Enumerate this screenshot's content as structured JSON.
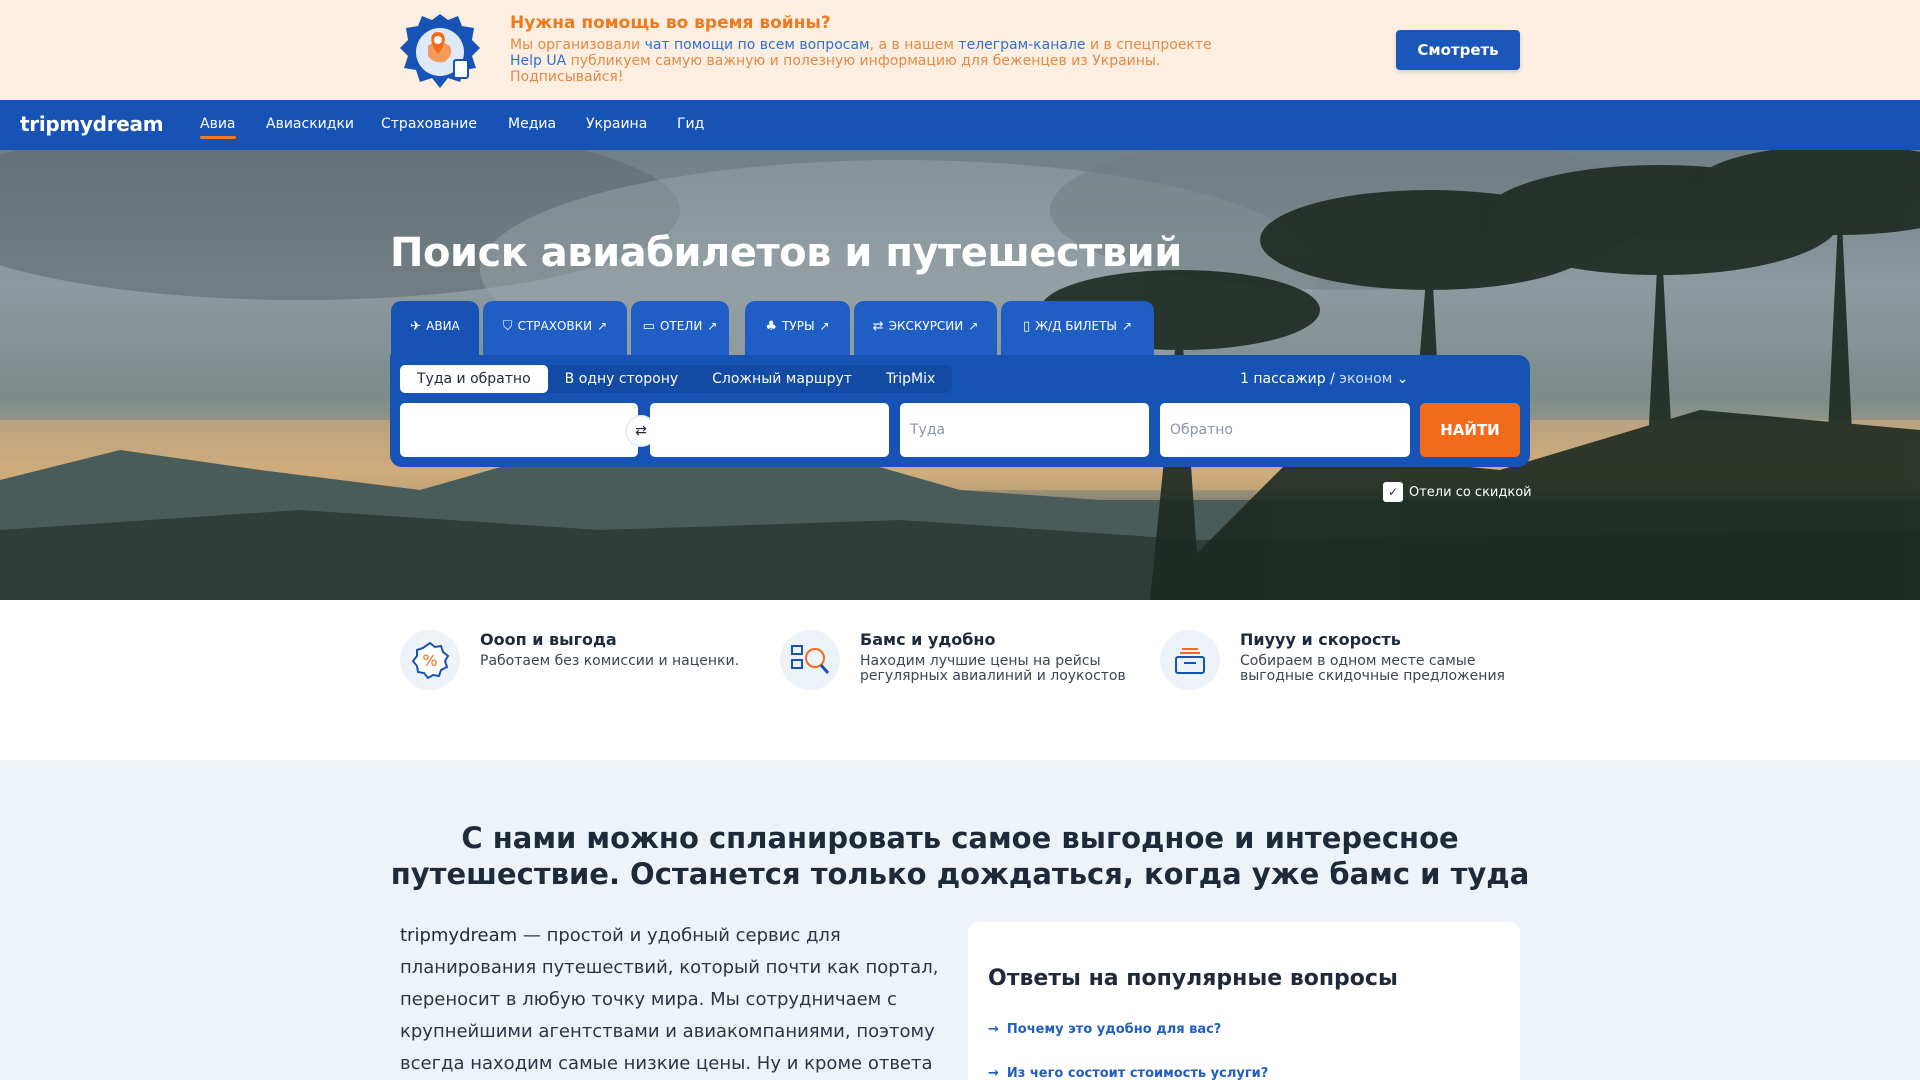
{
  "banner": {
    "title": "Нужна помощь во время войны?",
    "text_1": "Мы организовали ",
    "link_chat": "чат помощи по всем вопросам",
    "text_2": ", а в нашем ",
    "link_telegram": "телеграм-канале",
    "text_3": " и в спецпроекте ",
    "link_helpua": "Help UA",
    "text_4": " публикуем самую важную и полезную информацию для беженцев из Украины. Подписывайся!",
    "button_label": "Смотреть"
  },
  "nav": {
    "logo": "tripmydream",
    "items": [
      "Авиа",
      "Авиаскидки",
      "Страхование",
      "Медиа",
      "Украина",
      "Гид"
    ]
  },
  "hero": {
    "title": "Поиск авиабилетов и путешествий",
    "tabs": [
      {
        "label": "Авиа",
        "icon": "plane-icon"
      },
      {
        "label": "Страховки",
        "icon": "shield-icon"
      },
      {
        "label": "Отели",
        "icon": "bed-icon"
      },
      {
        "label": "Туры",
        "icon": "palm-icon"
      },
      {
        "label": "Экскурсии",
        "icon": "signpost-icon"
      },
      {
        "label": "Ж/Д билеты",
        "icon": "train-icon"
      }
    ],
    "external_arrow": "↗",
    "trip_types": [
      "Туда и обратно",
      "В одну сторону",
      "Сложный маршрут",
      "TripMix"
    ],
    "passengers": "1 пассажир",
    "passengers_sep": " / ",
    "cabin_class": "эконом",
    "from_placeholder": "",
    "to_placeholder": "",
    "depart_placeholder": "Туда",
    "return_placeholder": "Обратно",
    "search_button": "НАЙТИ",
    "hotels_checkbox": "Отели со скидкой"
  },
  "features": [
    {
      "title": "Оооп и выгода",
      "desc": "Работаем без комиссии и наценки.",
      "icon": "percent-icon"
    },
    {
      "title": "Бамс и удобно",
      "desc": "Находим лучшие цены на рейсы регулярных авиалиний и лоукостов",
      "icon": "search-money-icon"
    },
    {
      "title": "Пиууу и скорость",
      "desc": "Собираем в одном месте самые выгодные скидочные предложения",
      "icon": "box-icon"
    }
  ],
  "about": {
    "title_line1": "С нами можно спланировать самое выгодное и интересное",
    "title_line2": "путешествие. Останется только дождаться, когда уже бамс и туда",
    "brand": "tripmydream",
    "text": " — простой и удобный сервис для планирования путешествий, который почти как портал, переносит в любую точку мира. Мы сотрудничаем с крупнейшими агентствами и авиакомпаниями, поэтому всегда находим самые низкие цены. Ну и кроме ответа"
  },
  "faq": {
    "title": "Ответы на популярные вопросы",
    "questions": [
      "Почему это удобно для вас?",
      "Из чего состоит стоимость услуги?"
    ]
  },
  "colors": {
    "brand_blue": "#1753b5",
    "accent_orange": "#f26b1d",
    "banner_bg": "#fdeee2"
  }
}
